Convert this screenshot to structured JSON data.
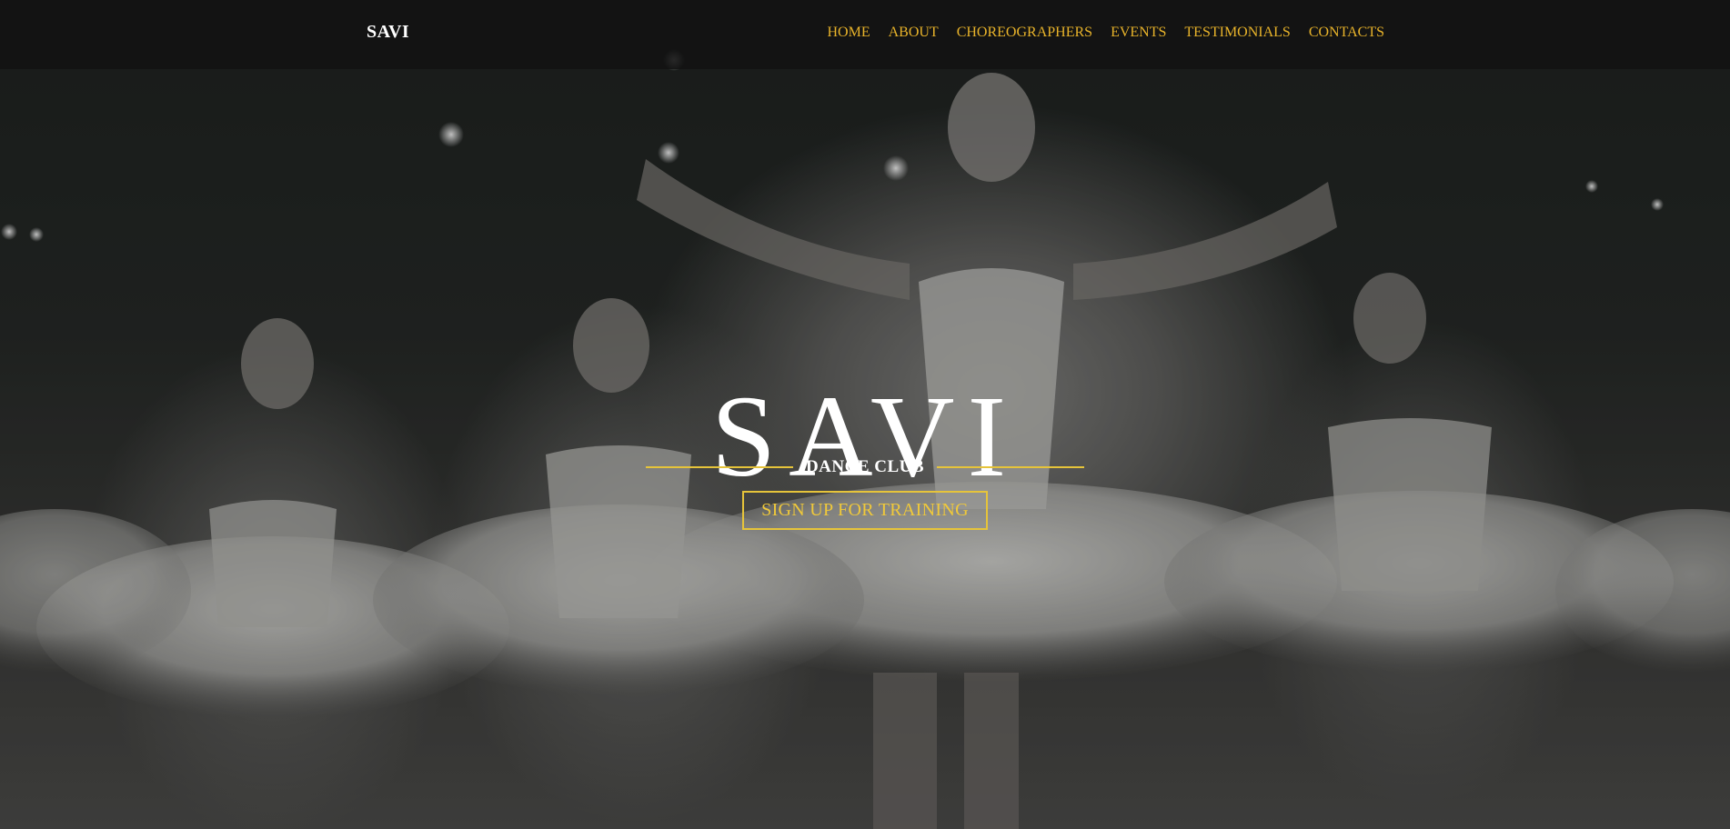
{
  "navbar": {
    "brand": "SAVI",
    "links": [
      "HOME",
      "ABOUT",
      "CHOREOGRAPHERS",
      "EVENTS",
      "TESTIMONIALS",
      "CONTACTS"
    ]
  },
  "hero": {
    "title": "SAVI",
    "subtitle": "DANCE CLUB",
    "cta_label": "SIGN UP FOR TRAINING"
  },
  "colors": {
    "accent": "#e8b32a",
    "navbar_bg": "#121212",
    "text": "#ffffff"
  }
}
